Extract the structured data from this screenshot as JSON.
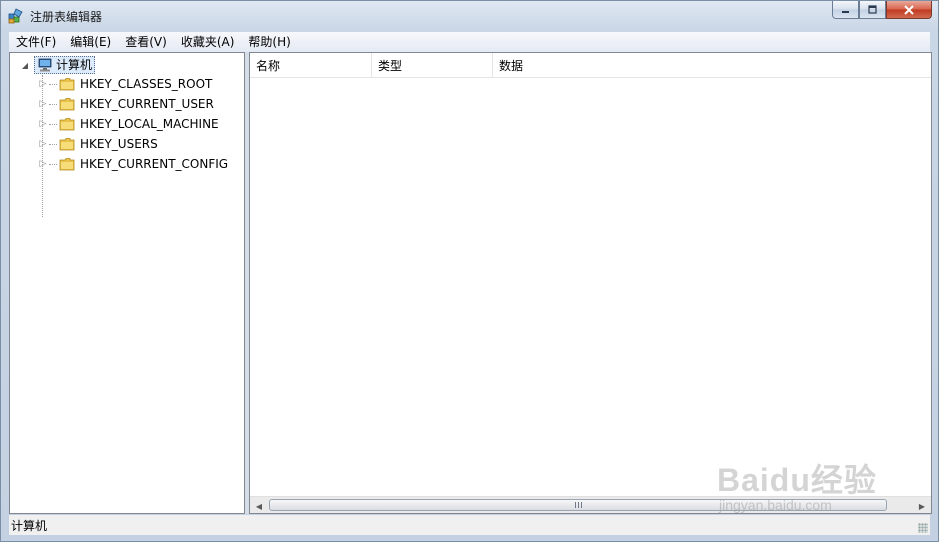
{
  "window": {
    "title": "注册表编辑器"
  },
  "menu": [
    {
      "label": "文件(F)"
    },
    {
      "label": "编辑(E)"
    },
    {
      "label": "查看(V)"
    },
    {
      "label": "收藏夹(A)"
    },
    {
      "label": "帮助(H)"
    }
  ],
  "tree": {
    "root": {
      "label": "计算机",
      "icon": "computer-icon",
      "expanded": true
    },
    "items": [
      {
        "label": "HKEY_CLASSES_ROOT",
        "icon": "folder-icon"
      },
      {
        "label": "HKEY_CURRENT_USER",
        "icon": "folder-icon"
      },
      {
        "label": "HKEY_LOCAL_MACHINE",
        "icon": "folder-icon"
      },
      {
        "label": "HKEY_USERS",
        "icon": "folder-icon"
      },
      {
        "label": "HKEY_CURRENT_CONFIG",
        "icon": "folder-icon"
      }
    ]
  },
  "list": {
    "columns": [
      {
        "label": "名称"
      },
      {
        "label": "类型"
      },
      {
        "label": "数据"
      }
    ]
  },
  "status": {
    "path": "计算机"
  },
  "watermark": {
    "text": "Baidu经验",
    "url": "jingyan.baidu.com"
  },
  "colors": {
    "folder": "#e8c24a",
    "selection": "#dcebfc",
    "close_button": "#c1391f"
  }
}
